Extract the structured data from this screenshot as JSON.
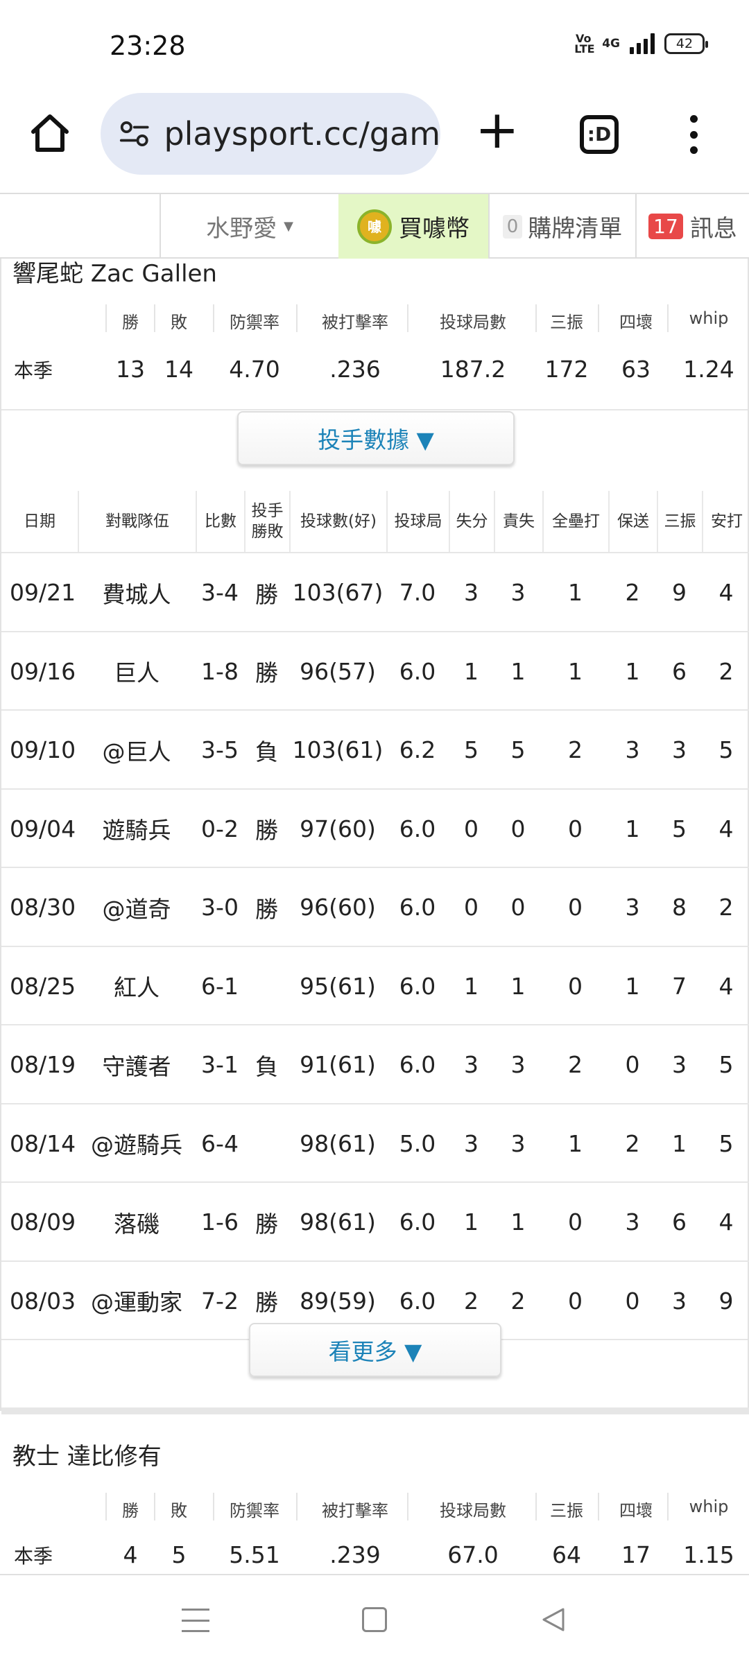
{
  "status_bar": {
    "time": "23:28",
    "volte": "VoLTE",
    "network": "4G",
    "battery": "42"
  },
  "browser": {
    "url": "playsport.cc/gam",
    "tabs_label": ":D"
  },
  "site_nav": {
    "user_name": "水野愛",
    "coin_label": "買噱幣",
    "coin_icon_text": "噱",
    "cart_count": "0",
    "cart_label": "購牌清單",
    "msg_count": "17",
    "msg_label": "訊息"
  },
  "pitcher1": {
    "name": "響尾蛇 Zac Gallen",
    "headers": [
      "勝",
      "敗",
      "防禦率",
      "被打擊率",
      "投球局數",
      "三振",
      "四壞",
      "whip"
    ],
    "season_label": "本季",
    "season": [
      "13",
      "14",
      "4.70",
      ".236",
      "187.2",
      "172",
      "63",
      "1.24"
    ]
  },
  "pitch_data_button": "投手數據 ▼",
  "game_log": {
    "headers": [
      "日期",
      "對戰隊伍",
      "比數",
      "投手勝敗",
      "投球數(好)",
      "投球局",
      "失分",
      "責失",
      "全壘打",
      "保送",
      "三振",
      "安打"
    ],
    "rows": [
      {
        "date": "09/21",
        "opp": "費城人",
        "s1": "3",
        "s2": "4",
        "c1": "",
        "c2": "g",
        "res": "勝",
        "rc": "g",
        "pitches": "103(67)",
        "ip": "7.0",
        "r": "3",
        "er": "3",
        "hr": "1",
        "bb": "2",
        "so": "9",
        "h": "4"
      },
      {
        "date": "09/16",
        "opp": "巨人",
        "s1": "1",
        "s2": "8",
        "c1": "",
        "c2": "g",
        "res": "勝",
        "rc": "g",
        "pitches": "96(57)",
        "ip": "6.0",
        "r": "1",
        "er": "1",
        "hr": "1",
        "bb": "1",
        "so": "6",
        "h": "2"
      },
      {
        "date": "09/10",
        "opp": "@巨人",
        "s1": "3",
        "s2": "5",
        "c1": "r",
        "c2": "",
        "res": "負",
        "rc": "r",
        "pitches": "103(61)",
        "ip": "6.2",
        "r": "5",
        "er": "5",
        "hr": "2",
        "bb": "3",
        "so": "3",
        "h": "5"
      },
      {
        "date": "09/04",
        "opp": "遊騎兵",
        "s1": "0",
        "s2": "2",
        "c1": "",
        "c2": "g",
        "res": "勝",
        "rc": "g",
        "pitches": "97(60)",
        "ip": "6.0",
        "r": "0",
        "er": "0",
        "hr": "0",
        "bb": "1",
        "so": "5",
        "h": "4"
      },
      {
        "date": "08/30",
        "opp": "@道奇",
        "s1": "3",
        "s2": "0",
        "c1": "g",
        "c2": "",
        "res": "勝",
        "rc": "g",
        "pitches": "96(60)",
        "ip": "6.0",
        "r": "0",
        "er": "0",
        "hr": "0",
        "bb": "3",
        "so": "8",
        "h": "2"
      },
      {
        "date": "08/25",
        "opp": "紅人",
        "s1": "6",
        "s2": "1",
        "c1": "",
        "c2": "r",
        "res": "",
        "rc": "",
        "pitches": "95(61)",
        "ip": "6.0",
        "r": "1",
        "er": "1",
        "hr": "0",
        "bb": "1",
        "so": "7",
        "h": "4"
      },
      {
        "date": "08/19",
        "opp": "守護者",
        "s1": "3",
        "s2": "1",
        "c1": "",
        "c2": "r",
        "res": "負",
        "rc": "r",
        "pitches": "91(61)",
        "ip": "6.0",
        "r": "3",
        "er": "3",
        "hr": "2",
        "bb": "0",
        "so": "3",
        "h": "5"
      },
      {
        "date": "08/14",
        "opp": "@遊騎兵",
        "s1": "6",
        "s2": "4",
        "c1": "g",
        "c2": "",
        "res": "",
        "rc": "",
        "pitches": "98(61)",
        "ip": "5.0",
        "r": "3",
        "er": "3",
        "hr": "1",
        "bb": "2",
        "so": "1",
        "h": "5"
      },
      {
        "date": "08/09",
        "opp": "落磯",
        "s1": "1",
        "s2": "6",
        "c1": "",
        "c2": "g",
        "res": "勝",
        "rc": "g",
        "pitches": "98(61)",
        "ip": "6.0",
        "r": "1",
        "er": "1",
        "hr": "0",
        "bb": "3",
        "so": "6",
        "h": "4"
      },
      {
        "date": "08/03",
        "opp": "@運動家",
        "s1": "7",
        "s2": "2",
        "c1": "g",
        "c2": "",
        "res": "勝",
        "rc": "g",
        "pitches": "89(59)",
        "ip": "6.0",
        "r": "2",
        "er": "2",
        "hr": "0",
        "bb": "0",
        "so": "3",
        "h": "9"
      }
    ]
  },
  "more_button": "看更多 ▼",
  "pitcher2": {
    "name": "教士 達比修有",
    "headers": [
      "勝",
      "敗",
      "防禦率",
      "被打擊率",
      "投球局數",
      "三振",
      "四壞",
      "whip"
    ],
    "season_label": "本季",
    "season": [
      "4",
      "5",
      "5.51",
      ".239",
      "67.0",
      "64",
      "17",
      "1.15"
    ]
  }
}
